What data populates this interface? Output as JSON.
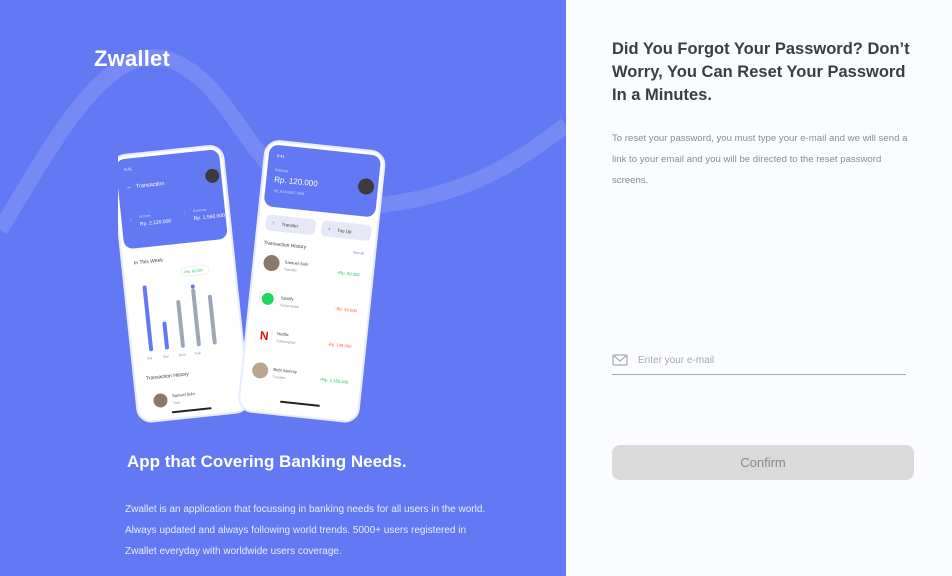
{
  "brand": {
    "name": "Zwallet"
  },
  "hero": {
    "tagline": "App that Covering Banking Needs.",
    "description": "Zwallet is an application that focussing in banking needs for all users in the world. Always updated and always following world trends. 5000+ users registered in Zwallet everyday with worldwide users coverage."
  },
  "phone_left": {
    "time": "9:41",
    "title": "Transaction",
    "income_label": "Income",
    "income_value": "Rp. 2.120.000",
    "expense_label": "Expense",
    "expense_value": "Rp. 1.560.000",
    "week_label": "In This Week",
    "bar_badge": "+Rp. 65.000",
    "days": [
      "Sat",
      "Sun",
      "Mon",
      "Tue"
    ],
    "history_label": "Transaction History",
    "history_item": "Samuel Suhi",
    "history_sub": "Tran..."
  },
  "phone_right": {
    "time": "9:41",
    "balance_label": "Balance",
    "balance_value": "Rp. 120.000",
    "phone_number": "+62 813-9387-7946",
    "transfer_label": "Transfer",
    "topup_label": "Top Up",
    "history_label": "Transaction History",
    "see_all": "See all",
    "items": [
      {
        "name": "Samuel Suhi",
        "type": "Transfer",
        "amount": "+Rp. 50.000",
        "color": "#1ec15f"
      },
      {
        "name": "Spotify",
        "type": "Subscription",
        "amount": "-Rp. 49.000",
        "color": "#ff5b37"
      },
      {
        "name": "Netflix",
        "type": "Subscription",
        "amount": "-Rp. 149.000",
        "color": "#ff5b37"
      },
      {
        "name": "Bobi Sammy",
        "type": "Transfer",
        "amount": "+Rp. 1.150.000",
        "color": "#1ec15f"
      }
    ]
  },
  "reset": {
    "heading": "Did You Forgot Your Password? Don’t Worry, You Can Reset Your Password In a Minutes.",
    "info": "To reset your password, you must type your e-mail and we will send a link to your email and you will be directed to the reset password screens.",
    "email_placeholder": "Enter your e-mail",
    "email_value": "",
    "confirm_label": "Confirm"
  },
  "colors": {
    "primary": "#6379f4",
    "heading": "#3a3d42",
    "muted": "#8a8d91",
    "button_disabled": "#dadada",
    "positive": "#1ec15f",
    "negative": "#ff5b37"
  },
  "icons": {
    "email": "mail-icon",
    "back": "arrow-left-icon",
    "transfer": "arrow-up-icon",
    "topup": "plus-icon"
  }
}
